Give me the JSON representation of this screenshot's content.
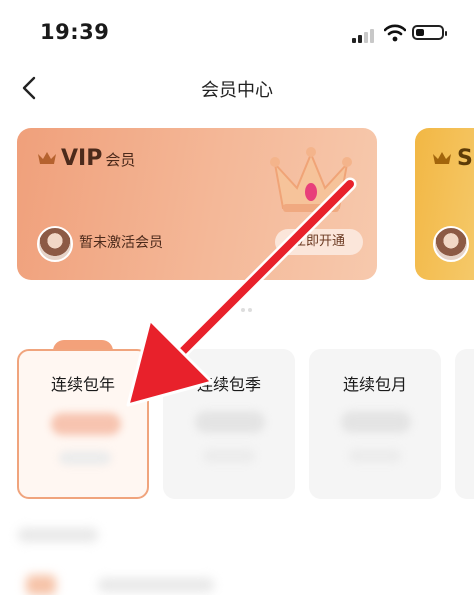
{
  "status_bar": {
    "time": "19:39",
    "battery_level": 0.25
  },
  "nav": {
    "title": "会员中心"
  },
  "vip_card": {
    "brand": "VIP",
    "suffix": "会员",
    "status_text": "暂未激活会员",
    "activate_label": "立即开通"
  },
  "next_card": {
    "brand": "S"
  },
  "plans": [
    {
      "label": "连续包年",
      "selected": true
    },
    {
      "label": "连续包季",
      "selected": false
    },
    {
      "label": "连续包月",
      "selected": false
    }
  ],
  "colors": {
    "vip_card": "#f0a07b",
    "svip_card": "#f2b744",
    "selected_border": "#f0a47d",
    "annotation_arrow": "#e8212b"
  }
}
